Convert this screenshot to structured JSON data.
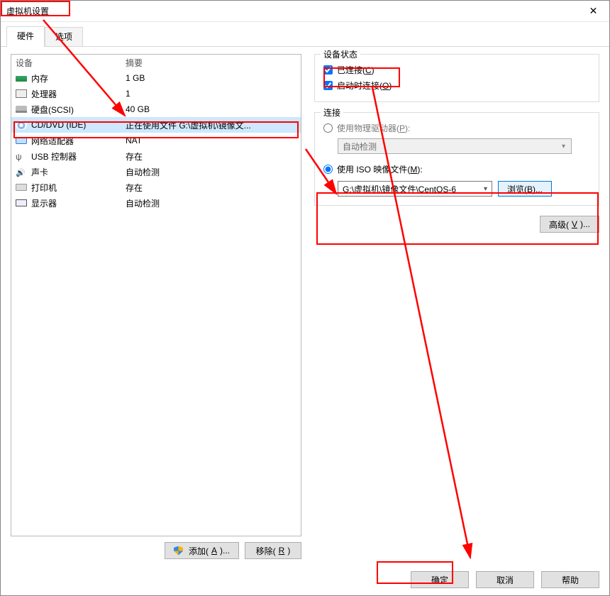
{
  "window": {
    "title": "虚拟机设置"
  },
  "tabs": {
    "hardware": "硬件",
    "options": "选项"
  },
  "device_list": {
    "col_device": "设备",
    "col_summary": "摘要",
    "items": [
      {
        "name": "内存",
        "summary": "1 GB",
        "icon": "mem"
      },
      {
        "name": "处理器",
        "summary": "1",
        "icon": "cpu"
      },
      {
        "name": "硬盘(SCSI)",
        "summary": "40 GB",
        "icon": "hdd"
      },
      {
        "name": "CD/DVD (IDE)",
        "summary": "正在使用文件 G:\\虚拟机\\镜像文...",
        "icon": "cd"
      },
      {
        "name": "网络适配器",
        "summary": "NAT",
        "icon": "net"
      },
      {
        "name": "USB 控制器",
        "summary": "存在",
        "icon": "usb"
      },
      {
        "name": "声卡",
        "summary": "自动检测",
        "icon": "snd"
      },
      {
        "name": "打印机",
        "summary": "存在",
        "icon": "prn"
      },
      {
        "name": "显示器",
        "summary": "自动检测",
        "icon": "mon"
      }
    ]
  },
  "left_buttons": {
    "add_prefix": "添加(",
    "add_key": "A",
    "add_suffix": ")...",
    "remove_prefix": "移除(",
    "remove_key": "R",
    "remove_suffix": ")"
  },
  "device_status": {
    "group_title": "设备状态",
    "connected_prefix": "已连接(",
    "connected_key": "C",
    "connected_suffix": ")",
    "connect_at_poweron_prefix": "启动时连接(",
    "connect_at_poweron_key": "O",
    "connect_at_poweron_suffix": ")"
  },
  "connection": {
    "group_title": "连接",
    "use_physical_prefix": "使用物理驱动器(",
    "use_physical_key": "P",
    "use_physical_suffix": "):",
    "physical_value": "自动检测",
    "use_iso_prefix": "使用 ISO 映像文件(",
    "use_iso_key": "M",
    "use_iso_suffix": "):",
    "iso_path": "G:\\虚拟机\\镜像文件\\CentOS-6",
    "browse_prefix": "浏览(",
    "browse_key": "B",
    "browse_suffix": ")..."
  },
  "advanced": {
    "prefix": "高级(",
    "key": "V",
    "suffix": ")..."
  },
  "footer": {
    "ok": "确定",
    "cancel": "取消",
    "help": "帮助"
  }
}
